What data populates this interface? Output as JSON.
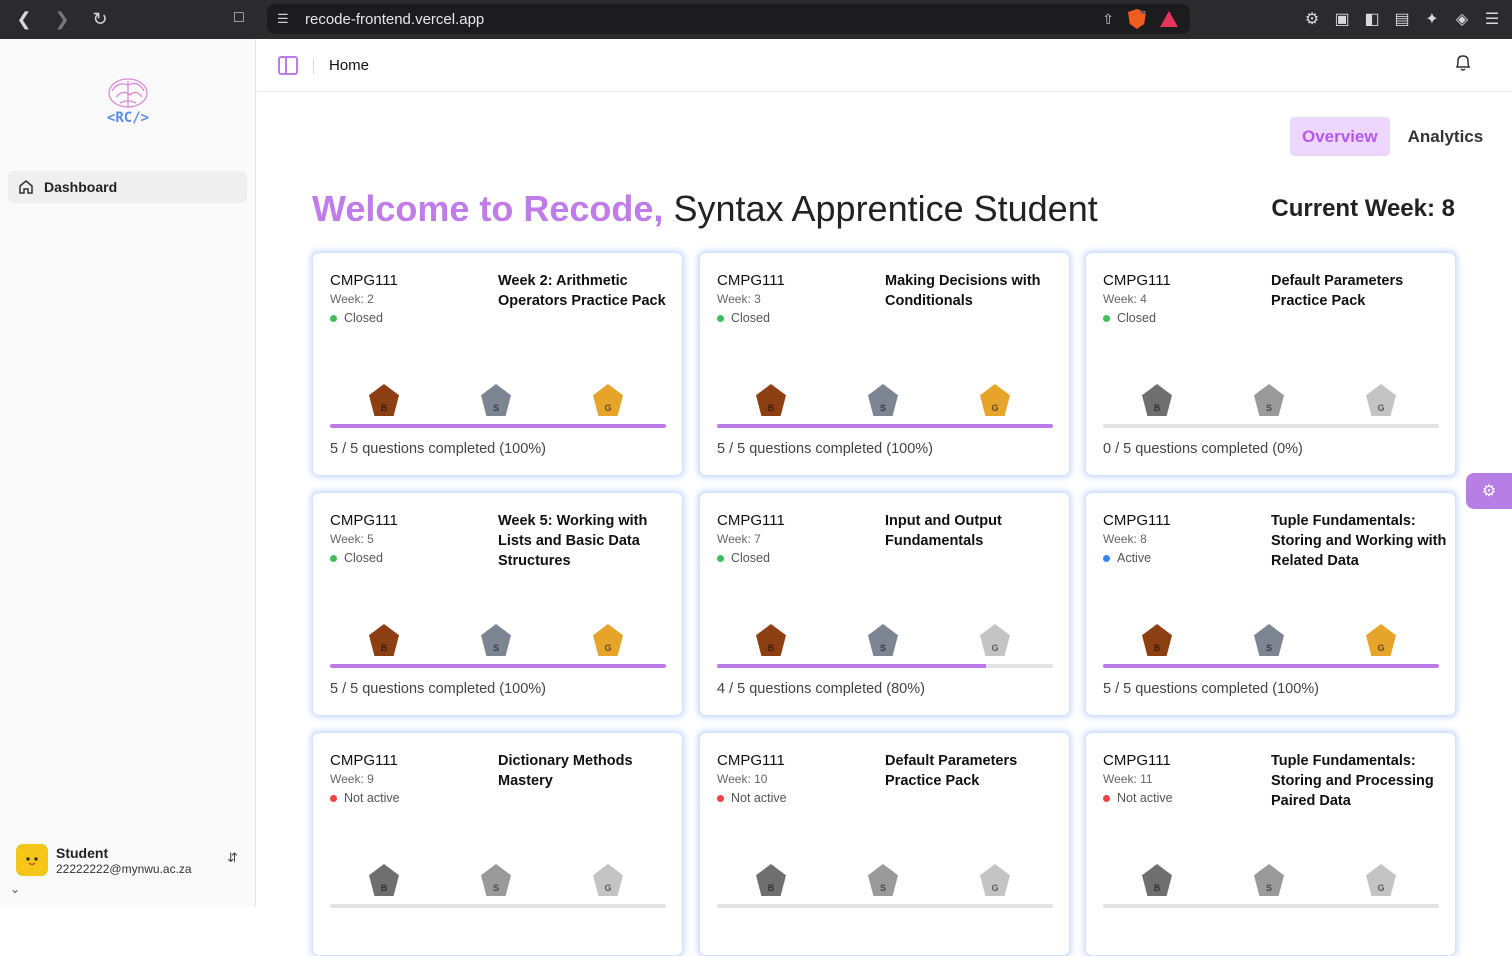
{
  "browser": {
    "url": "recode-frontend.vercel.app",
    "shield_count": "1"
  },
  "sidebar": {
    "nav": [
      {
        "label": "Dashboard",
        "icon": "home-icon"
      }
    ],
    "user": {
      "name": "Student",
      "email": "22222222@mynwu.ac.za"
    }
  },
  "topbar": {
    "breadcrumb": "Home"
  },
  "tabs": [
    {
      "label": "Overview",
      "active": true
    },
    {
      "label": "Analytics",
      "active": false
    }
  ],
  "welcome": {
    "highlight": "Welcome to Recode,",
    "title": "Syntax Apprentice Student"
  },
  "current_week": "Current Week: 8",
  "colors": {
    "accent": "#bd79ea",
    "closed": "#3fbf5c",
    "active": "#3b82f6",
    "not_active": "#ef4444"
  },
  "cards": [
    {
      "course": "CMPG111",
      "week": "Week: 2",
      "status": "Closed",
      "title": "Week 2: Arithmetic Operators Practice Pack",
      "progress": "5 / 5 questions completed (100%)",
      "pct": 100
    },
    {
      "course": "CMPG111",
      "week": "Week: 3",
      "status": "Closed",
      "title": "Making Decisions with Conditionals",
      "progress": "5 / 5 questions completed (100%)",
      "pct": 100
    },
    {
      "course": "CMPG111",
      "week": "Week: 4",
      "status": "Closed",
      "title": "Default Parameters Practice Pack",
      "progress": "0 / 5 questions completed (0%)",
      "pct": 0
    },
    {
      "course": "CMPG111",
      "week": "Week: 5",
      "status": "Closed",
      "title": "Week 5: Working with Lists and Basic Data Structures",
      "progress": "5 / 5 questions completed (100%)",
      "pct": 100
    },
    {
      "course": "CMPG111",
      "week": "Week: 7",
      "status": "Closed",
      "title": "Input and Output Fundamentals",
      "progress": "4 / 5 questions completed (80%)",
      "pct": 80
    },
    {
      "course": "CMPG111",
      "week": "Week: 8",
      "status": "Active",
      "title": "Tuple Fundamentals: Storing and Working with Related Data",
      "progress": "5 / 5 questions completed (100%)",
      "pct": 100
    },
    {
      "course": "CMPG111",
      "week": "Week: 9",
      "status": "Not active",
      "title": "Dictionary Methods Mastery",
      "progress": "",
      "pct": 0
    },
    {
      "course": "CMPG111",
      "week": "Week: 10",
      "status": "Not active",
      "title": "Default Parameters Practice Pack",
      "progress": "",
      "pct": 0
    },
    {
      "course": "CMPG111",
      "week": "Week: 11",
      "status": "Not active",
      "title": "Tuple Fundamentals: Storing and Processing Paired Data",
      "progress": "",
      "pct": 0
    }
  ],
  "badge_letters": [
    "B",
    "S",
    "G"
  ]
}
